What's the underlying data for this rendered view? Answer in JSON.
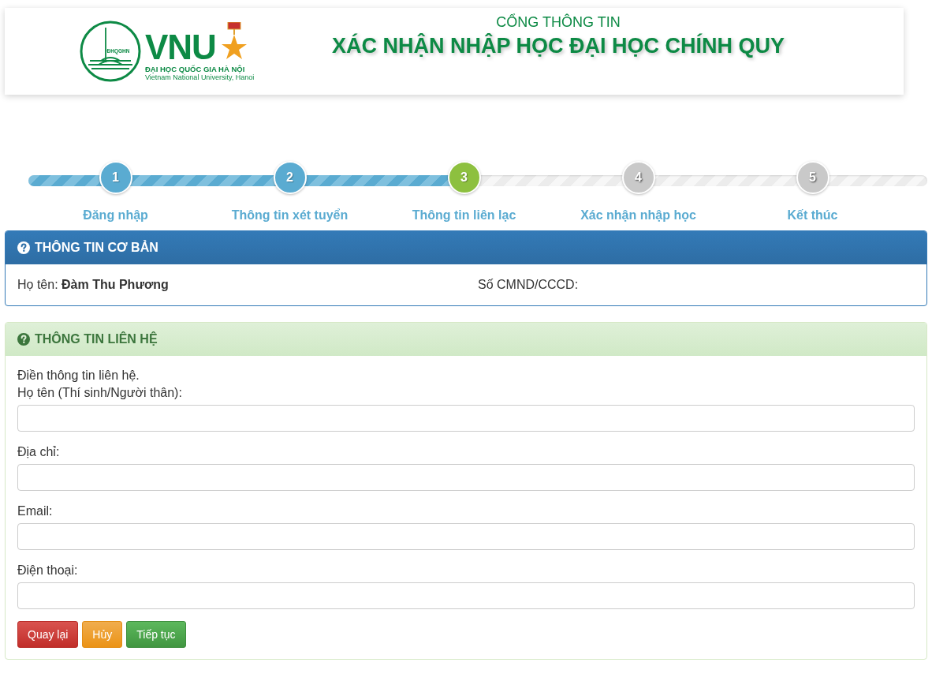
{
  "header": {
    "logo": {
      "seal_text": "ĐHQGHN",
      "acronym": "VNU",
      "name": "ĐẠI HỌC QUỐC GIA HÀ NỘI",
      "english_name": "Vietnam National University, Hanoi"
    },
    "subtitle": "CỔNG THÔNG TIN",
    "title": "XÁC NHẬN NHẬP HỌC ĐẠI HỌC CHÍNH QUY"
  },
  "steps": [
    {
      "number": "1",
      "label": "Đăng nhập",
      "done": true,
      "selected": false
    },
    {
      "number": "2",
      "label": "Thông tin xét tuyển",
      "done": true,
      "selected": false
    },
    {
      "number": "3",
      "label": "Thông tin liên lạc",
      "done": false,
      "selected": true
    },
    {
      "number": "4",
      "label": "Xác nhận nhập học",
      "done": false,
      "selected": false
    },
    {
      "number": "5",
      "label": "Kết thúc",
      "done": false,
      "selected": false
    }
  ],
  "basic_panel": {
    "title": "THÔNG TIN CƠ BẢN",
    "fields": [
      {
        "label": "Họ tên:",
        "value": "Đàm Thu Phương"
      },
      {
        "label": "Số CMND/CCCD:"
      }
    ]
  },
  "contact_panel": {
    "title": "THÔNG TIN LIÊN HỆ",
    "intro": "Điền thông tin liên hệ.",
    "fields": [
      {
        "label": "Họ tên (Thí sinh/Người thân):"
      },
      {
        "label": "Địa chỉ:"
      },
      {
        "label": "Email:"
      },
      {
        "label": "Điện thoại:"
      }
    ],
    "buttons": [
      {
        "label": "Quay lại",
        "kind": "danger"
      },
      {
        "label": "Hủy",
        "kind": "warning"
      },
      {
        "label": "Tiếp tục",
        "kind": "success"
      }
    ]
  }
}
